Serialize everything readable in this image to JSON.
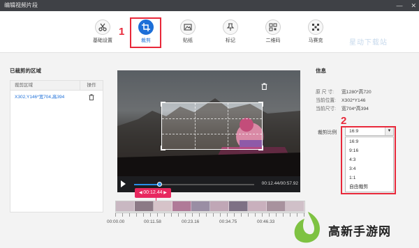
{
  "window": {
    "title": "编辑视频片段",
    "min": "—",
    "close": "✕"
  },
  "toolbar": {
    "tools": [
      {
        "label": "基础设置",
        "icon": "scissors-icon"
      },
      {
        "label": "裁剪",
        "icon": "crop-icon",
        "active": true
      },
      {
        "label": "贴纸",
        "icon": "image-icon"
      },
      {
        "label": "标记",
        "icon": "pin-icon"
      },
      {
        "label": "二维码",
        "icon": "qrcode-icon"
      },
      {
        "label": "马赛克",
        "icon": "mosaic-icon"
      }
    ],
    "step1": "1",
    "watermark": "星动下载站"
  },
  "left": {
    "title": "已裁剪的区域",
    "col_region": "裁剪区域",
    "col_action": "操作",
    "rows": [
      {
        "region": "X302,Y146*宽704,高394",
        "action_icon": "trash-icon"
      }
    ]
  },
  "player": {
    "time": "00:12.44/00:57.92",
    "progress": 0.215
  },
  "timeline": {
    "marker": "00:12.44",
    "labels": [
      "00:00.00",
      "00:11.58",
      "00:23.16",
      "00:34.75",
      "00:46.33"
    ]
  },
  "info": {
    "title": "信息",
    "rows": [
      {
        "k": "原 尺 寸:",
        "v": "宽1280*高720"
      },
      {
        "k": "当前位置:",
        "v": "X302*Y146"
      },
      {
        "k": "当前尺寸:",
        "v": "宽704*高394"
      }
    ],
    "ratio_label": "裁剪比例",
    "ratio_selected": "16:9",
    "ratio_options": [
      "16:9",
      "9:16",
      "4:3",
      "3:4",
      "1:1",
      "自由裁剪"
    ],
    "step2": "2"
  },
  "brand": {
    "text": "高新手游网"
  },
  "colors": {
    "accent": "#1d6fd8",
    "highlight": "#e8283a",
    "marker": "#e8285f"
  }
}
